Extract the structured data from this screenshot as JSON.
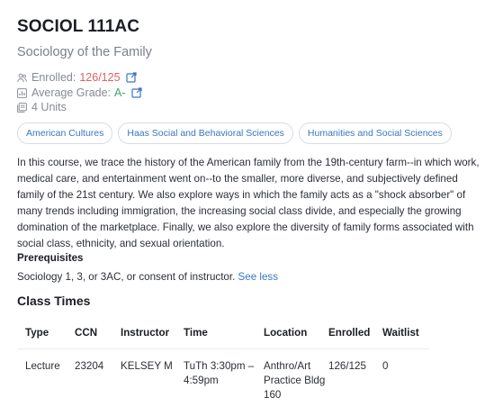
{
  "course": {
    "code": "SOCIOL 111AC",
    "title": "Sociology of the Family",
    "enrolled_label": "Enrolled:",
    "enrolled_value": "126/125",
    "grade_label": "Average Grade:",
    "grade_value": "A-",
    "units": "4 Units",
    "colors": {
      "enrolled": "#e0605f",
      "grade": "#3aa76d",
      "link": "#3a76c4"
    }
  },
  "tags": [
    "American Cultures",
    "Haas Social and Behavioral Sciences",
    "Humanities and Social Sciences"
  ],
  "description": "In this course, we trace the history of the American family from the 19th-century farm--in which work, medical care, and entertainment went on--to the smaller, more diverse, and subjectively defined family of the 21st century. We also explore ways in which the family acts as a \"shock absorber\" of many trends including immigration, the increasing social class divide, and especially the growing domination of the marketplace. Finally, we also explore the diversity of family forms associated with social class, ethnicity, and sexual orientation.",
  "prerequisites": {
    "heading": "Prerequisites",
    "text": "Sociology 1, 3, or 3AC, or consent of instructor.",
    "toggle": "See less"
  },
  "class_times": {
    "heading": "Class Times",
    "columns": [
      "Type",
      "CCN",
      "Instructor",
      "Time",
      "Location",
      "Enrolled",
      "Waitlist"
    ],
    "rows": [
      [
        "Lecture",
        "23204",
        "KELSEY M",
        "TuTh 3:30pm – 4:59pm",
        "Anthro/Art Practice Bldg 160",
        "126/125",
        "0"
      ]
    ]
  },
  "icons": [
    "people-icon",
    "grade-chart-icon",
    "external-link-icon",
    "units-book-icon"
  ]
}
